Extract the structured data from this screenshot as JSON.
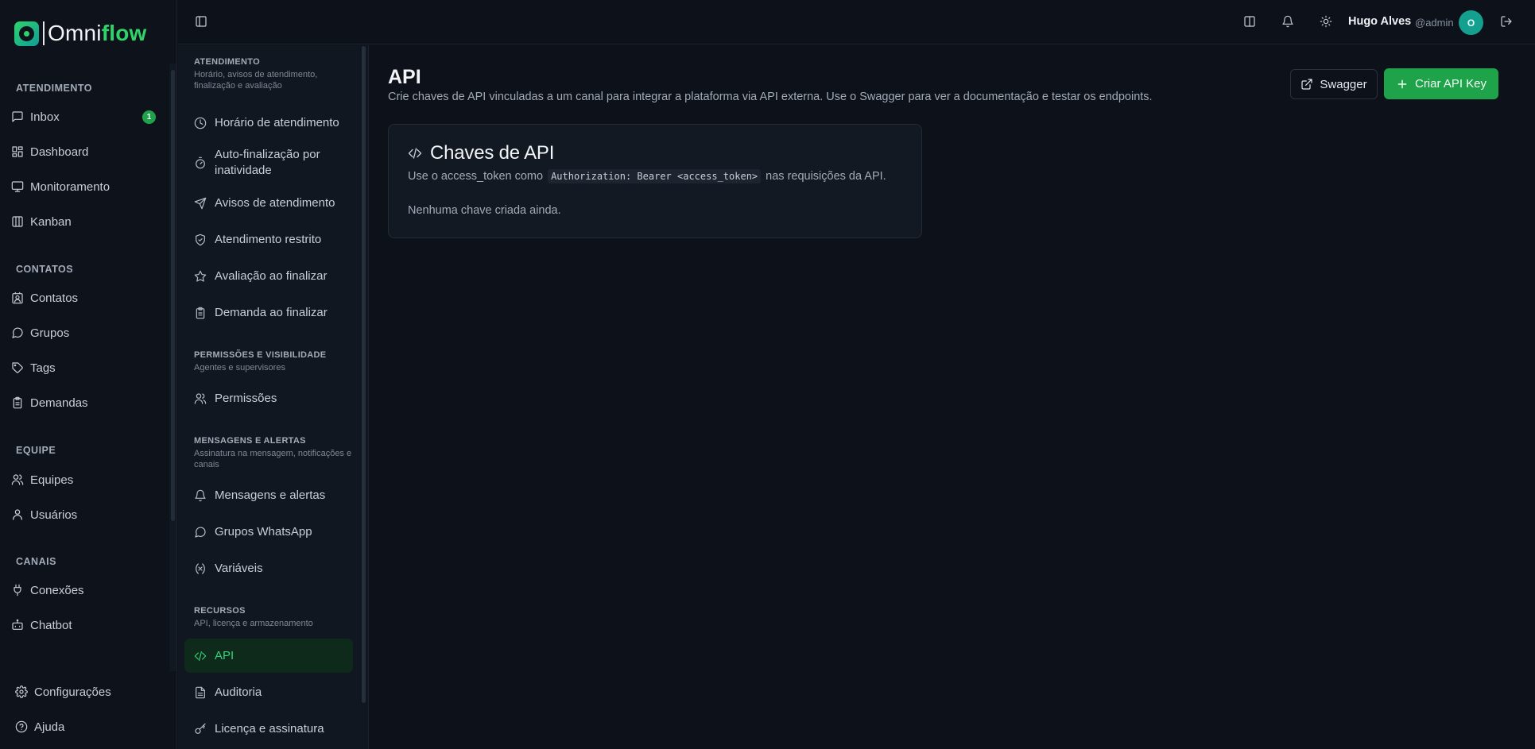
{
  "brand": {
    "name_part1": "Omni",
    "name_part2": "flow"
  },
  "sidebar": {
    "sections": [
      {
        "title": "ATENDIMENTO",
        "items": [
          {
            "label": "Inbox",
            "icon": "message-square-icon",
            "badge": "1"
          },
          {
            "label": "Dashboard",
            "icon": "layout-dashboard-icon"
          },
          {
            "label": "Monitoramento",
            "icon": "monitor-icon"
          },
          {
            "label": "Kanban",
            "icon": "kanban-icon"
          }
        ]
      },
      {
        "title": "CONTATOS",
        "items": [
          {
            "label": "Contatos",
            "icon": "contact-icon"
          },
          {
            "label": "Grupos",
            "icon": "message-circle-icon"
          },
          {
            "label": "Tags",
            "icon": "tag-icon"
          },
          {
            "label": "Demandas",
            "icon": "clipboard-icon"
          }
        ]
      },
      {
        "title": "EQUIPE",
        "items": [
          {
            "label": "Equipes",
            "icon": "users-icon"
          },
          {
            "label": "Usuários",
            "icon": "user-icon"
          }
        ]
      },
      {
        "title": "CANAIS",
        "items": [
          {
            "label": "Conexões",
            "icon": "plug-icon"
          },
          {
            "label": "Chatbot",
            "icon": "bot-icon"
          }
        ]
      }
    ],
    "footer": {
      "settings": "Configurações",
      "help": "Ajuda"
    }
  },
  "topbar": {
    "user_name": "Hugo Alves",
    "user_handle": "@admin",
    "avatar_initial": "O"
  },
  "submenu": {
    "groups": [
      {
        "title": "ATENDIMENTO",
        "desc": "Horário, avisos de atendimento, finalização e avaliação",
        "items": [
          "Horário de atendimento",
          "Auto-finalização por inatividade",
          "Avisos de atendimento",
          "Atendimento restrito",
          "Avaliação ao finalizar",
          "Demanda ao finalizar"
        ]
      },
      {
        "title": "PERMISSÕES E VISIBILIDADE",
        "desc": "Agentes e supervisores",
        "items": [
          "Permissões"
        ]
      },
      {
        "title": "MENSAGENS E ALERTAS",
        "desc": "Assinatura na mensagem, notificações e canais",
        "items": [
          "Mensagens e alertas",
          "Grupos WhatsApp",
          "Variáveis"
        ]
      },
      {
        "title": "RECURSOS",
        "desc": "API, licença e armazenamento",
        "items": [
          "API",
          "Auditoria",
          "Licença e assinatura"
        ]
      }
    ],
    "active": "API"
  },
  "main": {
    "title": "API",
    "description": "Crie chaves de API vinculadas a um canal para integrar a plataforma via API externa. Use o Swagger para ver a documentação e testar os endpoints.",
    "swagger_label": "Swagger",
    "create_label": "Criar API Key",
    "card": {
      "title": "Chaves de API",
      "desc_before": "Use o access_token como",
      "desc_code": "Authorization: Bearer <access_token>",
      "desc_after": "nas requisições da API.",
      "empty": "Nenhuma chave criada ainda."
    }
  },
  "colors": {
    "accent": "#1fa34a",
    "accent_text": "#37d27a",
    "background": "#0c111a"
  }
}
